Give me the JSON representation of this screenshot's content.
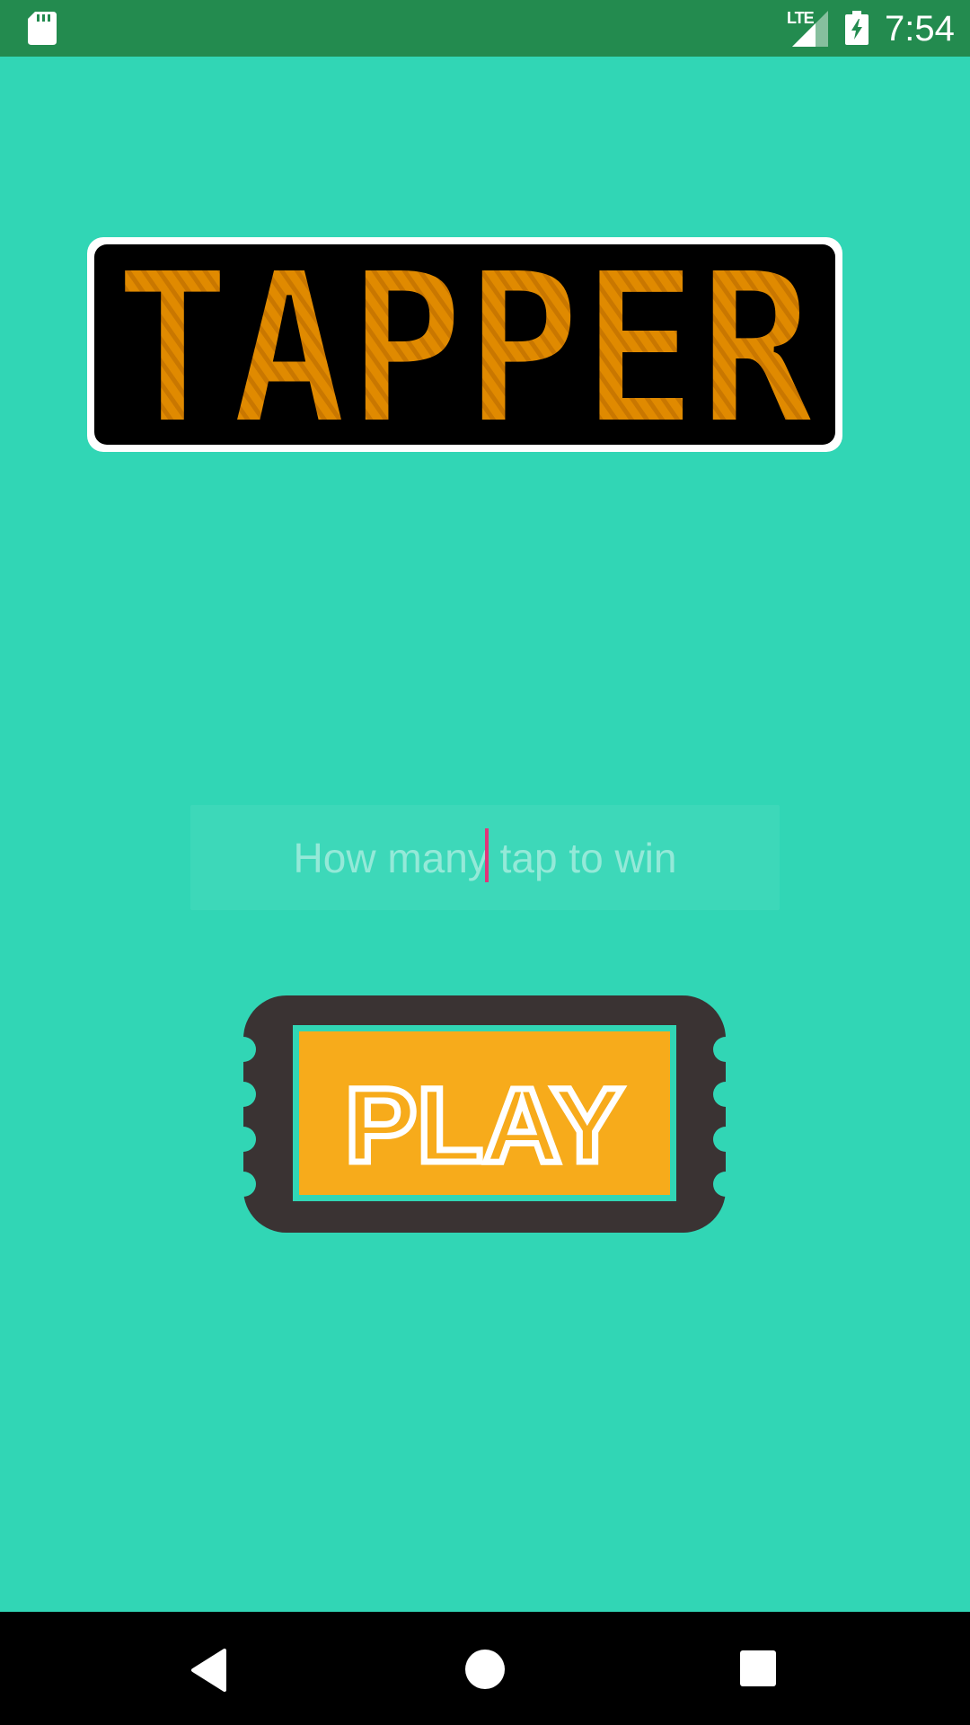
{
  "status_bar": {
    "network_type": "LTE",
    "time": "7:54",
    "icons": [
      "sd-card-icon",
      "signal-icon",
      "battery-charging-icon"
    ]
  },
  "logo": {
    "text": "TAPPER"
  },
  "tap_input": {
    "value": "",
    "placeholder": "How many tap to win"
  },
  "play_button": {
    "label": "PLAY"
  },
  "nav_bar": {
    "icons": [
      "back-icon",
      "home-icon",
      "recent-apps-icon"
    ]
  },
  "colors": {
    "background": "#31d6b5",
    "status_bar": "#238b4f",
    "logo_fill": "#e08a00",
    "play_fill": "#f7ab1b",
    "play_frame": "#3a3333",
    "caret": "#e0357a"
  }
}
